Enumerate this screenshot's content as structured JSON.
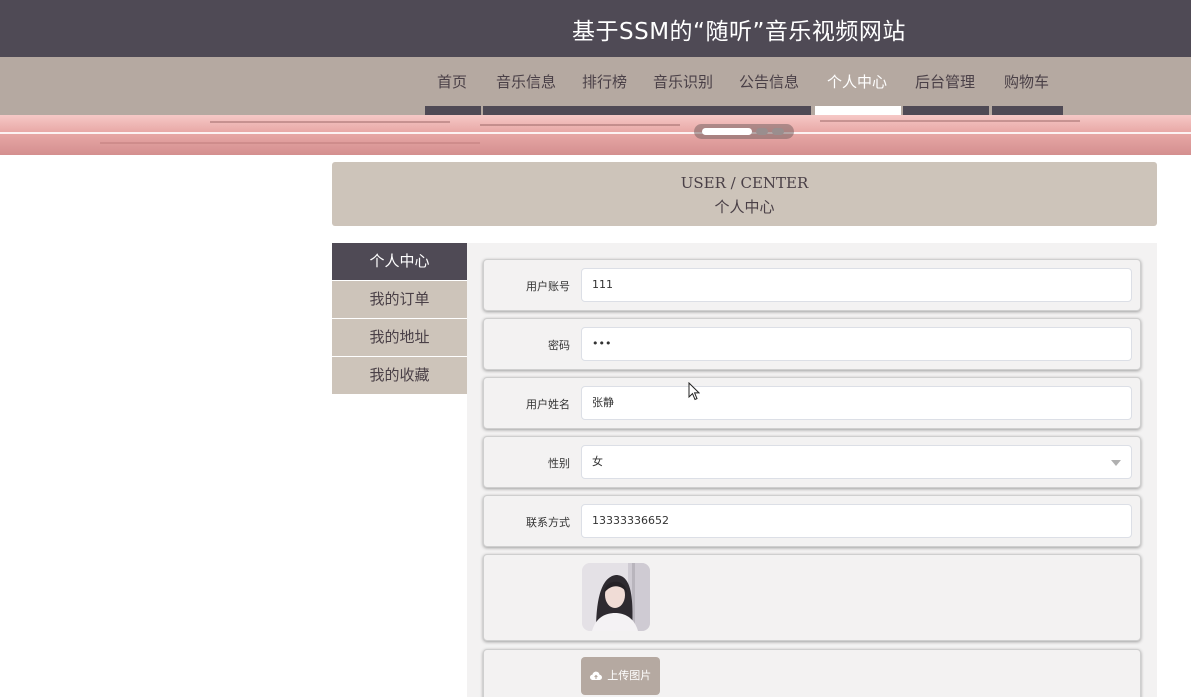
{
  "site": {
    "title": "基于SSM的“随听”音乐视频网站"
  },
  "nav": {
    "items": [
      {
        "label": "首页"
      },
      {
        "label": "音乐信息"
      },
      {
        "label": "排行榜"
      },
      {
        "label": "音乐识别"
      },
      {
        "label": "公告信息"
      },
      {
        "label": "个人中心",
        "active": true
      },
      {
        "label": "后台管理"
      },
      {
        "label": "购物车"
      }
    ]
  },
  "page_header": {
    "en": "USER / CENTER",
    "cn": "个人中心"
  },
  "sidebar": {
    "items": [
      {
        "label": "个人中心",
        "active": true
      },
      {
        "label": "我的订单"
      },
      {
        "label": "我的地址"
      },
      {
        "label": "我的收藏"
      }
    ]
  },
  "form": {
    "account": {
      "label": "用户账号",
      "value": "111"
    },
    "password": {
      "label": "密码",
      "value": "•••"
    },
    "name": {
      "label": "用户姓名",
      "value": "张静"
    },
    "gender": {
      "label": "性别",
      "value": "女"
    },
    "contact": {
      "label": "联系方式",
      "value": "13333336652"
    },
    "upload_label": "上传图片"
  },
  "colors": {
    "header_dark": "#4f4a55",
    "nav_bg": "#b5a9a1",
    "panel_beige": "#cdc4ba",
    "active_white": "#ffffff"
  },
  "icons": {
    "upload": "cloud-upload-icon",
    "select": "chevron-down-icon",
    "cursor": "mouse-pointer-icon"
  }
}
